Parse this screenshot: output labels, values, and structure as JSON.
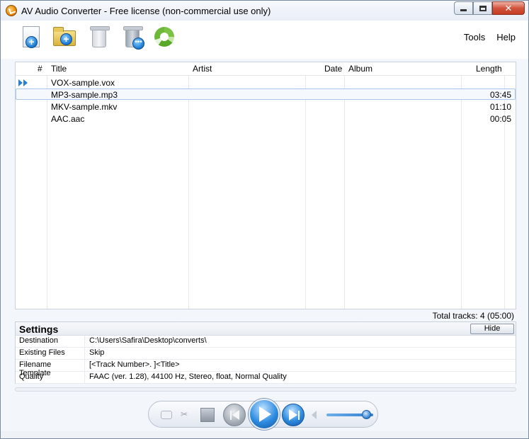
{
  "window": {
    "title": "AV Audio Converter - Free license (non-commercial use only)"
  },
  "menu": {
    "tools": "Tools",
    "help": "Help"
  },
  "toolbar": {
    "icons": [
      "add-file-icon",
      "add-folder-icon",
      "remove-icon",
      "clear-list-icon",
      "convert-icon"
    ]
  },
  "tracklist": {
    "columns": [
      "#",
      "Title",
      "Artist",
      "Date",
      "Album",
      "Length"
    ],
    "rows": [
      {
        "title": "VOX-sample.vox",
        "length": "",
        "playing": true
      },
      {
        "title": "MP3-sample.mp3",
        "length": "03:45",
        "selected": true
      },
      {
        "title": "MKV-sample.mkv",
        "length": "01:10"
      },
      {
        "title": "AAC.aac",
        "length": "00:05"
      }
    ],
    "total": "Total tracks: 4 (05:00)"
  },
  "settings": {
    "title": "Settings",
    "hide_label": "Hide",
    "rows": [
      {
        "key": "Destination",
        "value": "C:\\Users\\Safira\\Desktop\\converts\\"
      },
      {
        "key": "Existing Files",
        "value": "Skip"
      },
      {
        "key": "Filename Template",
        "value": "[<Track Number>. ]<Title>"
      },
      {
        "key": "Quality",
        "value": "FAAC (ver. 1.28), 44100 Hz, Stereo, float, Normal Quality"
      }
    ]
  },
  "player": {
    "volume_level": 0.85
  },
  "colors": {
    "accent": "#2d8be0",
    "selection_border": "#a9c6ea"
  }
}
